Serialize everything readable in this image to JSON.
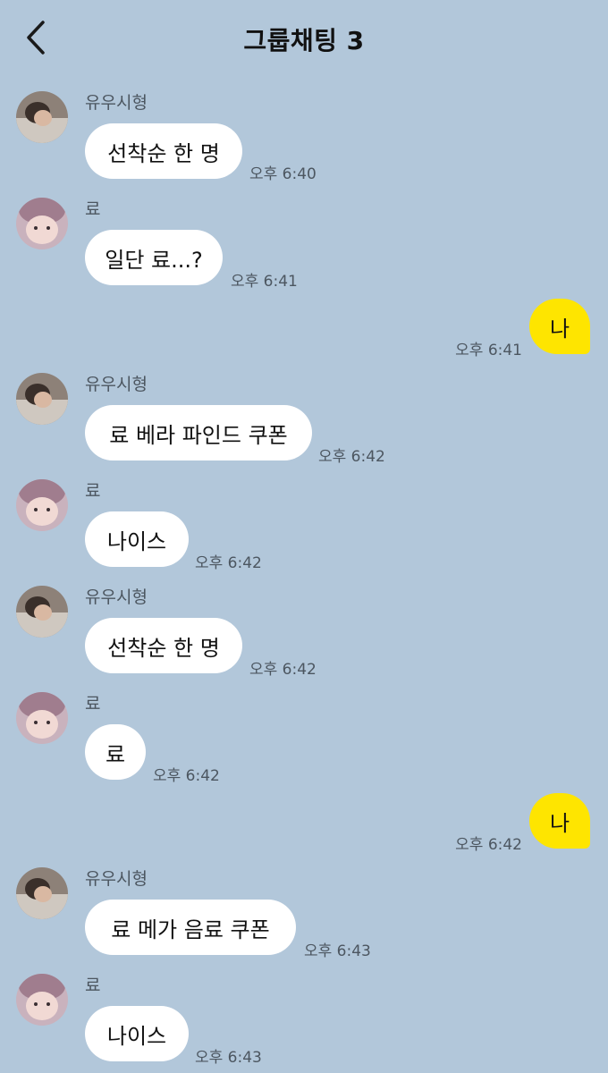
{
  "header": {
    "title": "그룹채팅 3"
  },
  "participants": {
    "yoo": {
      "name": "유우시형",
      "avatar_color": "#7a6e66"
    },
    "ryo": {
      "name": "료",
      "avatar_color": "#b89aa6"
    }
  },
  "colors": {
    "background": "#b2c7da",
    "bubble_other": "#ffffff",
    "bubble_me": "#fee500"
  },
  "messages": [
    {
      "from": "유우시형",
      "text": "선착순 한 명",
      "time": "오후 6:40"
    },
    {
      "from": "료",
      "text": "일단 료...?",
      "time": "오후 6:41"
    },
    {
      "from": "me",
      "text": "나",
      "time": "오후 6:41"
    },
    {
      "from": "유우시형",
      "text": "료 베라 파인드 쿠폰",
      "time": "오후 6:42"
    },
    {
      "from": "료",
      "text": "나이스",
      "time": "오후 6:42"
    },
    {
      "from": "유우시형",
      "text": "선착순 한 명",
      "time": "오후 6:42"
    },
    {
      "from": "료",
      "text": "료",
      "time": "오후 6:42"
    },
    {
      "from": "me",
      "text": "나",
      "time": "오후 6:42"
    },
    {
      "from": "유우시형",
      "text": "료 메가 음료 쿠폰",
      "time": "오후 6:43"
    },
    {
      "from": "료",
      "text": "나이스",
      "time": "오후 6:43"
    }
  ]
}
